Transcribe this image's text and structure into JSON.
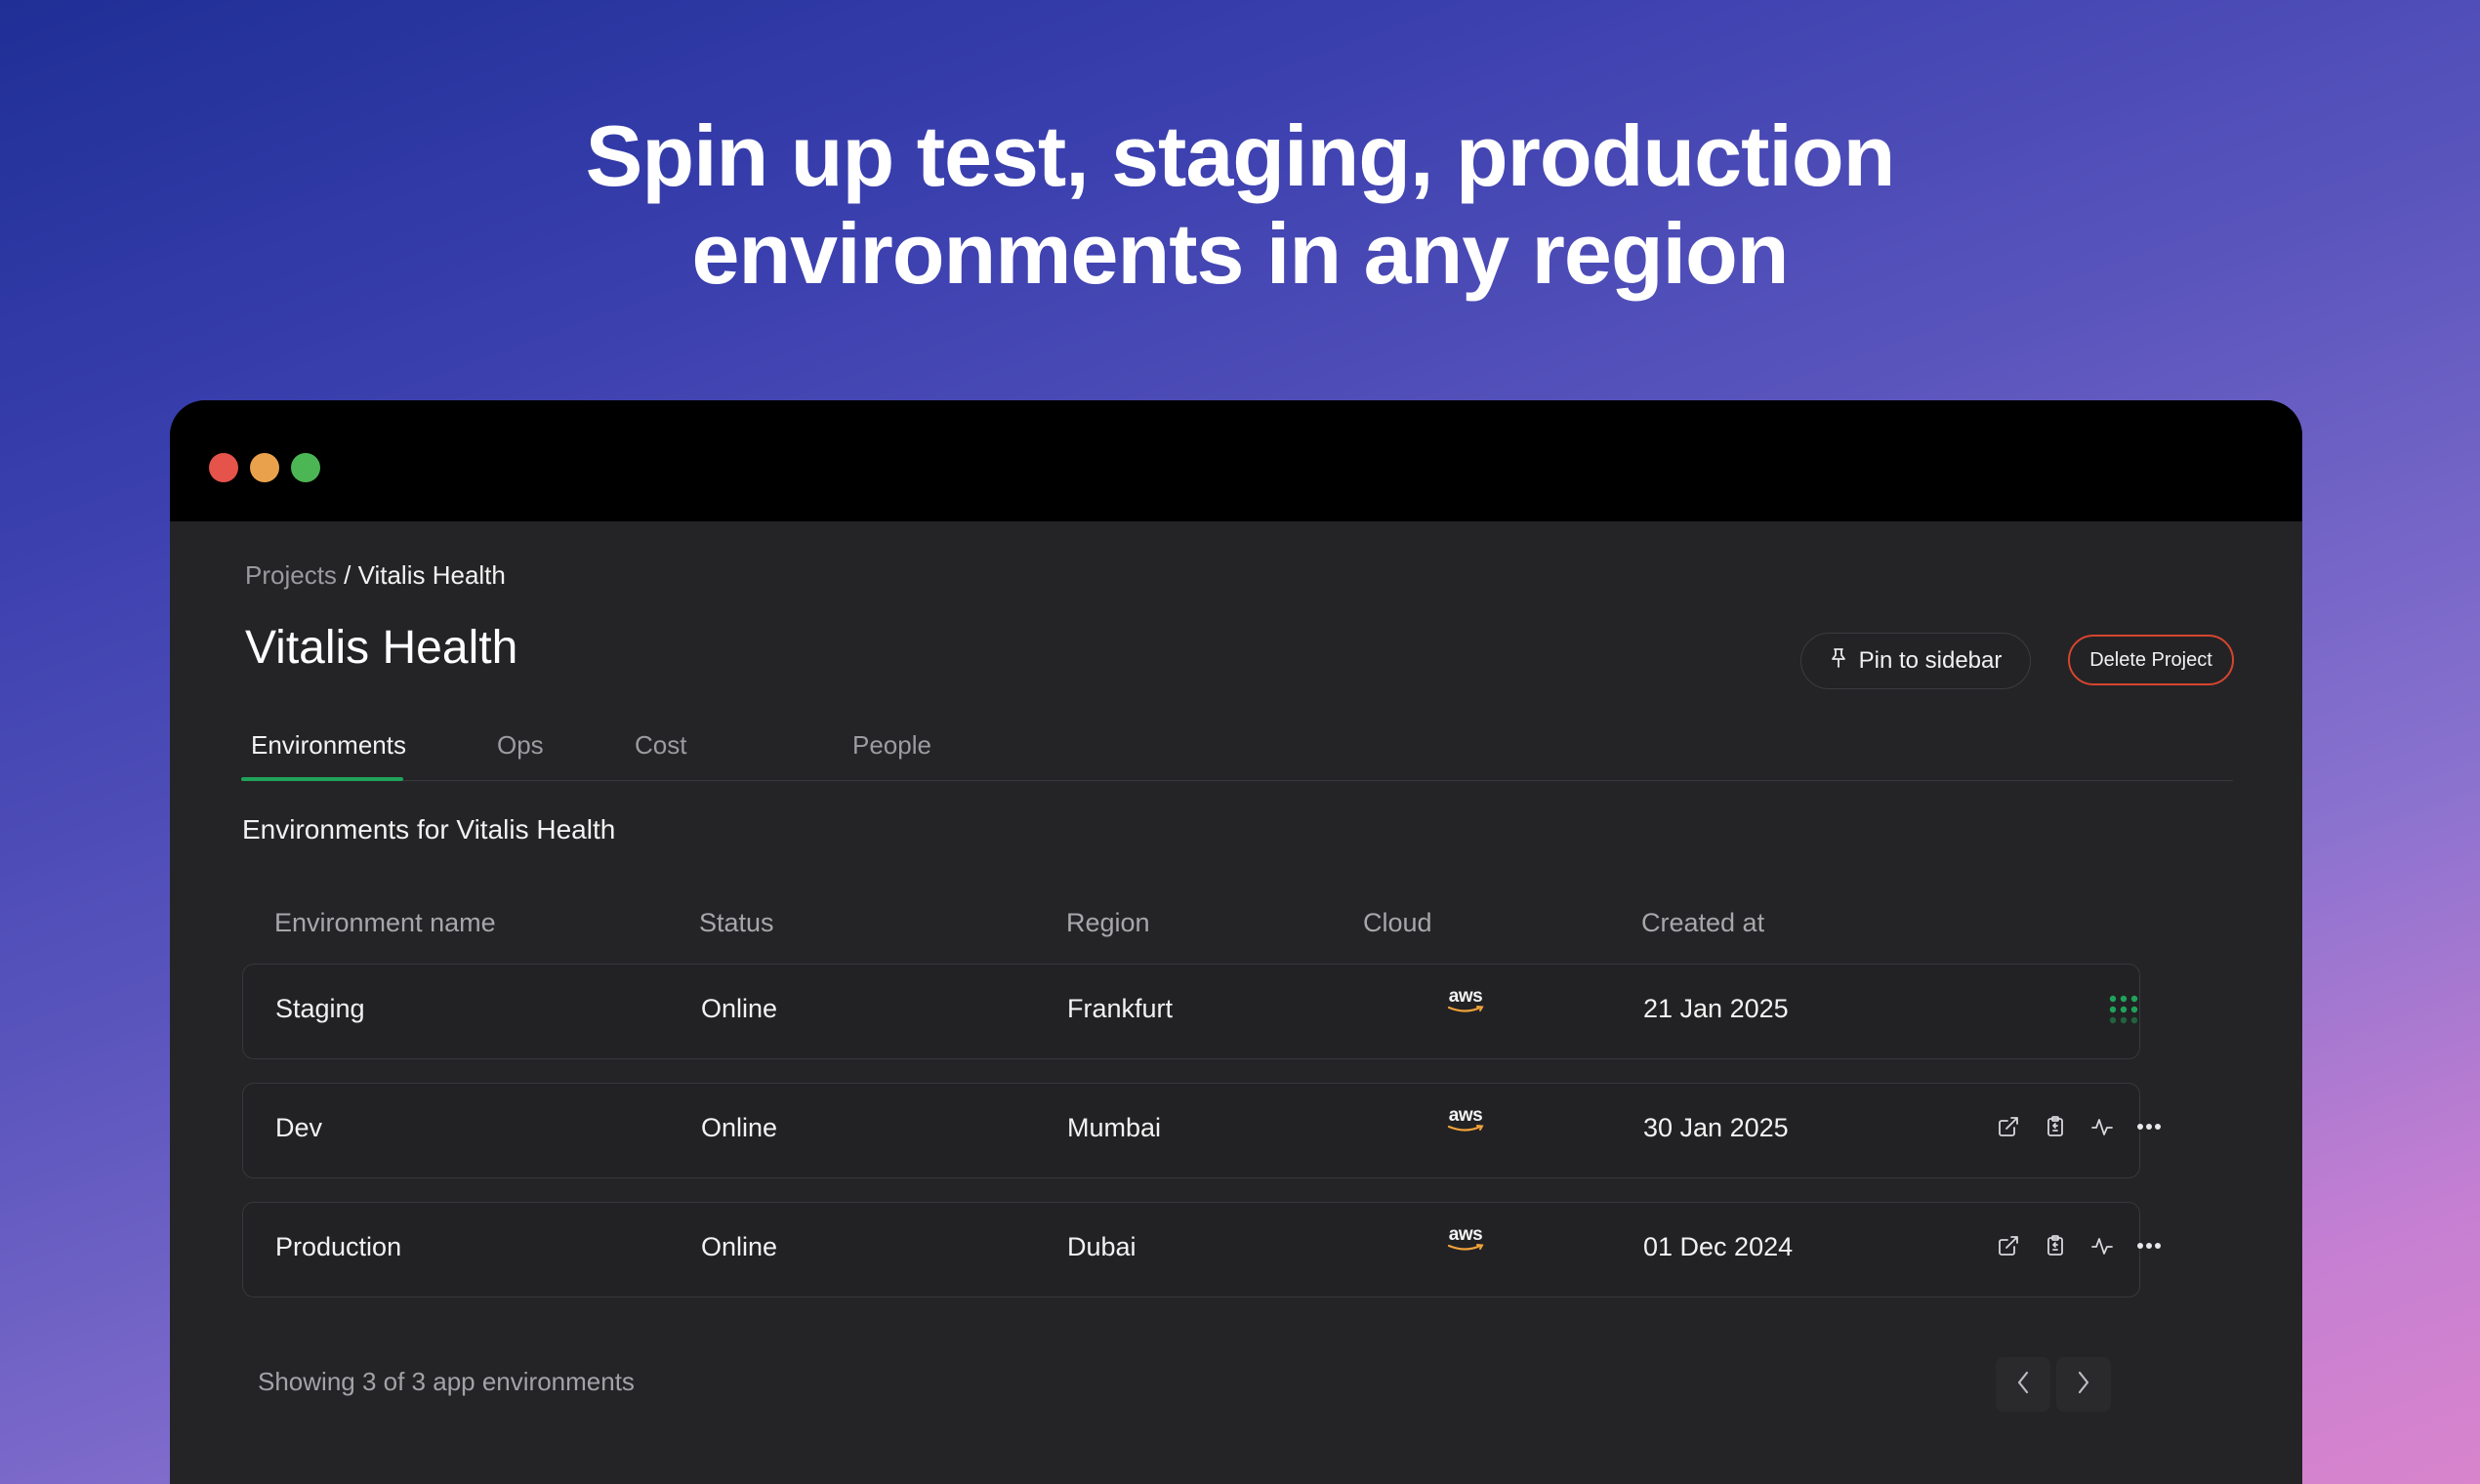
{
  "headline": {
    "line1": "Spin up test, staging, production",
    "line2": "environments in any region"
  },
  "breadcrumb": {
    "root": "Projects",
    "separator": " / ",
    "current": "Vitalis Health"
  },
  "page_title": "Vitalis Health",
  "header_buttons": {
    "pin_label": "Pin to sidebar",
    "delete_label": "Delete Project"
  },
  "tabs": [
    {
      "label": "Environments",
      "active": true
    },
    {
      "label": "Ops",
      "active": false
    },
    {
      "label": "Cost",
      "active": false
    },
    {
      "label": "People",
      "active": false
    }
  ],
  "section_title": "Environments for Vitalis Health",
  "table": {
    "columns": [
      "Environment name",
      "Status",
      "Region",
      "Cloud",
      "Created at"
    ],
    "rows": [
      {
        "name": "Staging",
        "status": "Online",
        "region": "Frankfurt",
        "cloud": "aws",
        "created": "21 Jan 2025"
      },
      {
        "name": "Dev",
        "status": "Online",
        "region": "Mumbai",
        "cloud": "aws",
        "created": "30 Jan 2025"
      },
      {
        "name": "Production",
        "status": "Online",
        "region": "Dubai",
        "cloud": "aws",
        "created": "01 Dec 2024"
      }
    ]
  },
  "footer": {
    "showing": "Showing 3 of 3 app environments"
  },
  "colors": {
    "accent_green": "#1fa35a",
    "danger_red": "#d6452f",
    "aws_orange": "#f0a23a"
  },
  "icons": {
    "row_actions": [
      "external-link-icon",
      "clipboard-icon",
      "activity-icon",
      "more-icon"
    ],
    "staging_action": "grid-dots-icon"
  }
}
